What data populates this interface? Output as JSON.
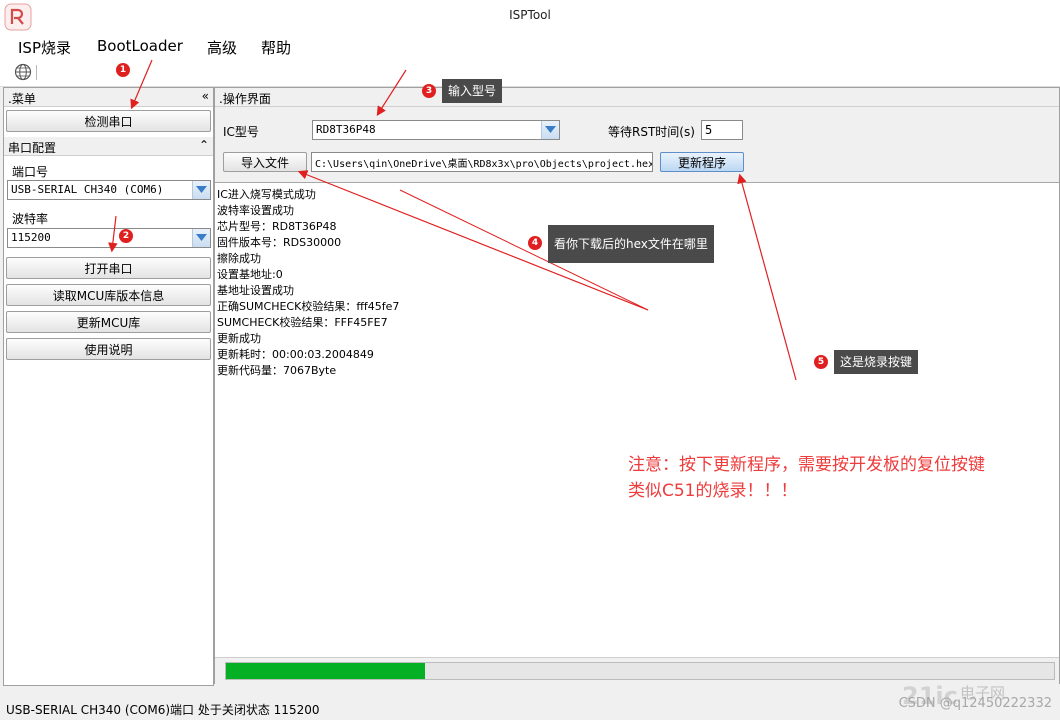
{
  "window": {
    "title": "ISPTool"
  },
  "menu": [
    "ISP烧录",
    "BootLoader",
    "高级",
    "帮助"
  ],
  "toolbar": {
    "icon": "globe-icon"
  },
  "left": {
    "menu_header": ".菜单",
    "menu_chevron": "«",
    "detect_button": "检测串口",
    "port_config_header": "串口配置",
    "port_config_chevron": "⌃",
    "port_label": "端口号",
    "port_value": "USB-SERIAL CH340 (COM6)",
    "baud_label": "波特率",
    "baud_value": "115200",
    "buttons": [
      "打开串口",
      "读取MCU库版本信息",
      "更新MCU库",
      "使用说明"
    ]
  },
  "right": {
    "header": ".操作界面",
    "ic_label": "IC型号",
    "ic_value": "RD8T36P48",
    "rst_label": "等待RST时间(s)",
    "rst_value": "5",
    "import_button": "导入文件",
    "file_path": "C:\\Users\\qin\\OneDrive\\桌面\\RD8x3x\\pro\\Objects\\project.hex",
    "update_button": "更新程序"
  },
  "log": [
    "IC进入烧写模式成功",
    "波特率设置成功",
    "芯片型号：RD8T36P48",
    "固件版本号：RDS30000",
    "擦除成功",
    "设置基地址:0",
    "基地址设置成功",
    "正确SUMCHECK校验结果：fff45fe7",
    "SUMCHECK校验结果：FFF45FE7",
    "更新成功",
    "更新耗时：00:00:03.2004849",
    "更新代码量：7067Byte"
  ],
  "progress": {
    "value": 0.24,
    "color": "#06b025"
  },
  "status": {
    "text": "USB-SERIAL CH340 (COM6)端口 处于关闭状态 115200"
  },
  "annotations": {
    "n1": "1",
    "n2": "2",
    "n3": "3",
    "n4": "4",
    "n5": "5",
    "a3": "输入型号",
    "a4": "看你下载后的hex文件在哪里",
    "a5": "这是烧录按键",
    "note_line1": "注意：按下更新程序，需要按开发板的复位按键",
    "note_line2": "类似C51的烧录！！！",
    "arrow_color": "#e02020",
    "note_color": "#ee3b3b"
  },
  "watermark": {
    "logo": "21ic",
    "site": "电子网",
    "csdn": "CSDN @q12450222332"
  }
}
